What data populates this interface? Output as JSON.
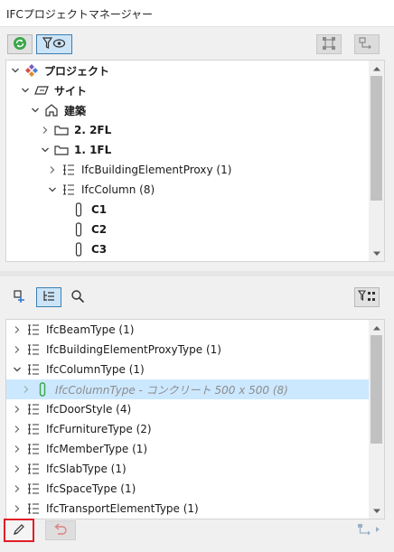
{
  "window": {
    "title": "IFCプロジェクトマネージャー"
  },
  "top_toolbar": {
    "refresh_icon": "refresh-icon",
    "filter_view_icon": "filter-eye-icon",
    "right_icons": [
      "structure-icon",
      "connection-icon"
    ]
  },
  "tree": {
    "items": [
      {
        "label": "プロジェクト",
        "bold": true,
        "expanded": true,
        "icon": "project-icon"
      },
      {
        "label": "サイト",
        "bold": true,
        "expanded": true,
        "icon": "site-icon"
      },
      {
        "label": "建築",
        "bold": true,
        "expanded": true,
        "icon": "building-icon"
      },
      {
        "label": "2. 2FL",
        "bold": true,
        "expanded": false,
        "icon": "storey-icon"
      },
      {
        "label": "1. 1FL",
        "bold": true,
        "expanded": true,
        "icon": "storey-icon"
      },
      {
        "label": "IfcBuildingElementProxy (1)",
        "bold": false,
        "expanded": false,
        "icon": "type-list-icon"
      },
      {
        "label": "IfcColumn (8)",
        "bold": false,
        "expanded": true,
        "icon": "type-list-icon"
      },
      {
        "label": "C1",
        "bold": true,
        "icon": "column-icon"
      },
      {
        "label": "C2",
        "bold": true,
        "icon": "column-icon"
      },
      {
        "label": "C3",
        "bold": true,
        "icon": "column-icon"
      }
    ]
  },
  "mid_toolbar": {
    "icons": [
      "add-element-icon",
      "hierarchy-icon",
      "search-icon"
    ],
    "right_icon": "filter-structure-icon"
  },
  "types": {
    "items": [
      {
        "label": "IfcBeamType (1)",
        "expanded": false
      },
      {
        "label": "IfcBuildingElementProxyType (1)",
        "expanded": false
      },
      {
        "label": "IfcColumnType (1)",
        "expanded": true
      },
      {
        "label": "IfcColumnType - コンクリート 500 x 500 (8)",
        "child": true,
        "selected": true
      },
      {
        "label": "IfcDoorStyle (4)",
        "expanded": false
      },
      {
        "label": "IfcFurnitureType (2)",
        "expanded": false
      },
      {
        "label": "IfcMemberType (1)",
        "expanded": false
      },
      {
        "label": "IfcSlabType (1)",
        "expanded": false
      },
      {
        "label": "IfcSpaceType (1)",
        "expanded": false
      },
      {
        "label": "IfcTransportElementType (1)",
        "expanded": false
      }
    ]
  },
  "footer": {
    "edit_icon": "pencil-icon",
    "undo_icon": "undo-icon",
    "right_icon": "connect-arrow-icon",
    "accent": "#e21e26"
  }
}
